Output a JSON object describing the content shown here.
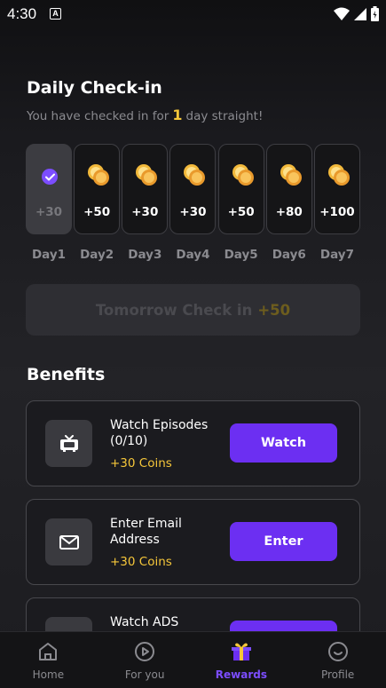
{
  "status_bar": {
    "time": "4:30",
    "notification_letter": "A"
  },
  "checkin": {
    "title": "Daily Check-in",
    "subtitle_prefix": "You have checked in for",
    "streak": "1",
    "subtitle_suffix": "day straight!",
    "days": [
      {
        "label": "Day1",
        "amount": "+30",
        "checked": true
      },
      {
        "label": "Day2",
        "amount": "+50",
        "checked": false
      },
      {
        "label": "Day3",
        "amount": "+30",
        "checked": false
      },
      {
        "label": "Day4",
        "amount": "+30",
        "checked": false
      },
      {
        "label": "Day5",
        "amount": "+50",
        "checked": false
      },
      {
        "label": "Day6",
        "amount": "+80",
        "checked": false
      },
      {
        "label": "Day7",
        "amount": "+100",
        "checked": false
      }
    ],
    "tomorrow_label": "Tomorrow Check in",
    "tomorrow_bonus": "+50"
  },
  "benefits": {
    "title": "Benefits",
    "items": [
      {
        "title": "Watch Episodes (0/10)",
        "reward": "+30 Coins",
        "button": "Watch",
        "icon": "tv-icon"
      },
      {
        "title": "Enter Email Address",
        "reward": "+30 Coins",
        "button": "Enter",
        "icon": "mail-icon"
      },
      {
        "title": "Watch ADS",
        "reward": "",
        "button": "",
        "icon": "ads-icon"
      }
    ]
  },
  "nav": {
    "items": [
      {
        "label": "Home",
        "icon": "home-icon",
        "active": false
      },
      {
        "label": "For you",
        "icon": "play-icon",
        "active": false
      },
      {
        "label": "Rewards",
        "icon": "gift-icon",
        "active": true
      },
      {
        "label": "Profile",
        "icon": "smile-icon",
        "active": false
      }
    ]
  },
  "colors": {
    "accent": "#6c2ff2",
    "coin": "#f6c73a",
    "muted": "#8b8b90"
  }
}
